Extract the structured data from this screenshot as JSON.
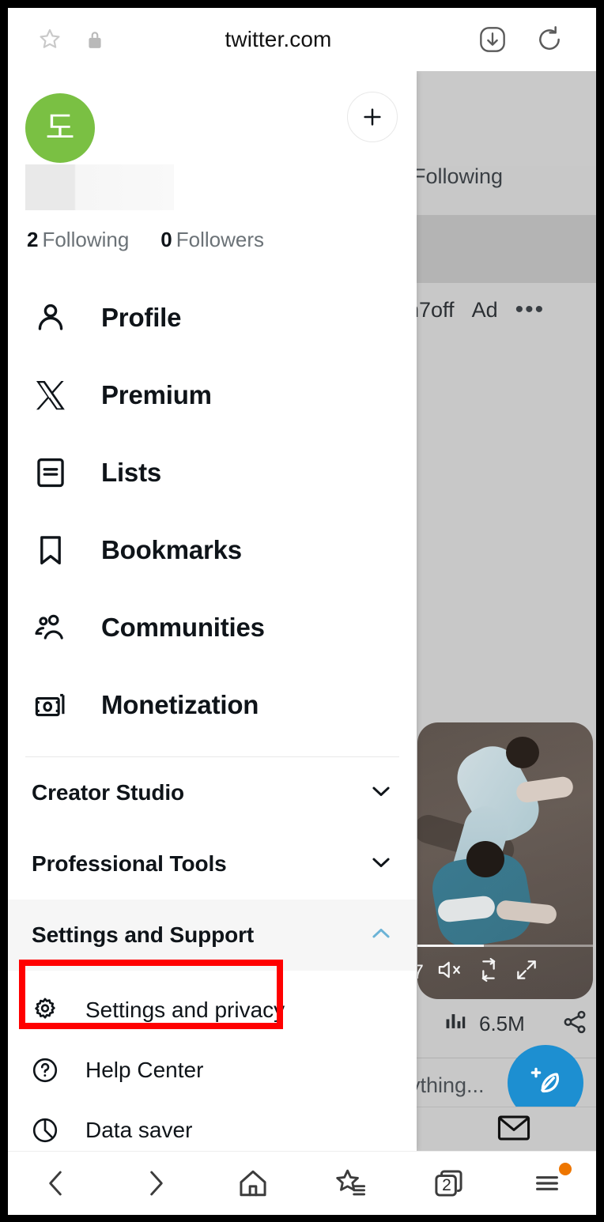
{
  "browser": {
    "url": "twitter.com",
    "icons": {
      "bookmark_star": "star-icon",
      "lock": "lock-icon",
      "download": "download-icon",
      "reload": "reload-icon"
    }
  },
  "drawer": {
    "avatar_initial": "도",
    "add_account_label": "+",
    "stats": {
      "following_count": "2",
      "following_label": "Following",
      "followers_count": "0",
      "followers_label": "Followers"
    },
    "nav": [
      {
        "label": "Profile",
        "icon": "person-icon"
      },
      {
        "label": "Premium",
        "icon": "x-logo-icon"
      },
      {
        "label": "Lists",
        "icon": "lists-icon"
      },
      {
        "label": "Bookmarks",
        "icon": "bookmark-icon"
      },
      {
        "label": "Communities",
        "icon": "communities-icon"
      },
      {
        "label": "Monetization",
        "icon": "money-icon"
      }
    ],
    "accordions": [
      {
        "label": "Creator Studio",
        "state": "collapsed",
        "chevron": "chevron-down-icon"
      },
      {
        "label": "Professional Tools",
        "state": "collapsed",
        "chevron": "chevron-down-icon"
      },
      {
        "label": "Settings and Support",
        "state": "expanded",
        "chevron": "chevron-up-icon"
      }
    ],
    "support_items": [
      {
        "label": "Settings and privacy",
        "icon": "gear-icon",
        "highlighted": true
      },
      {
        "label": "Help Center",
        "icon": "help-circle-icon",
        "highlighted": false
      },
      {
        "label": "Data saver",
        "icon": "data-saver-icon",
        "highlighted": false
      }
    ]
  },
  "backdrop": {
    "tab_label": "Following",
    "post_handle": "n7off",
    "ad_label": "Ad",
    "more_label": "•••",
    "video_time": "7",
    "views_count": "6.5M",
    "reply_placeholder": "ything...",
    "compose_icon": "compose-feather-icon",
    "mail_icon": "mail-icon",
    "share_icon": "share-icon",
    "analytics_icon": "analytics-icon",
    "mute_icon": "mute-icon",
    "loop_icon": "loop-icon",
    "expand_icon": "expand-icon"
  },
  "bottom_nav": {
    "items": [
      {
        "label": "Back",
        "icon": "chevron-left-icon"
      },
      {
        "label": "Forward",
        "icon": "chevron-right-icon"
      },
      {
        "label": "Home",
        "icon": "home-icon"
      },
      {
        "label": "Bookmarks",
        "icon": "star-list-icon"
      },
      {
        "label": "Tabs",
        "icon": "tabs-icon",
        "count": "2"
      },
      {
        "label": "Menu",
        "icon": "hamburger-icon",
        "badge": true
      }
    ]
  },
  "colors": {
    "avatar_green": "#7ac043",
    "accent_blue": "#1d8fd1",
    "chevron_active_blue": "#6bb3d6",
    "highlight_red": "#ff0000",
    "badge_orange": "#ee7600"
  }
}
